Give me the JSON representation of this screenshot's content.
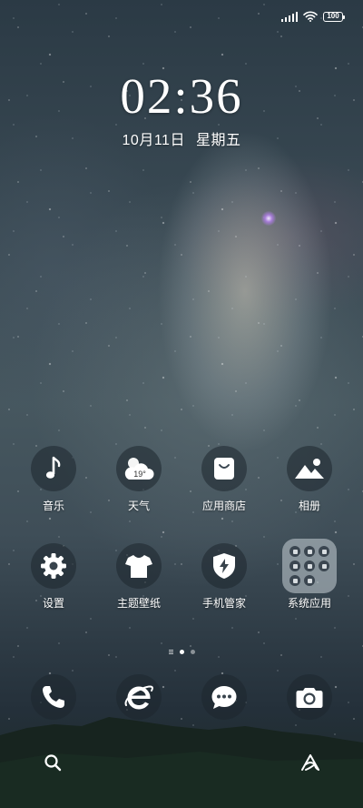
{
  "status_bar": {
    "battery_level": "100",
    "signal_icon": "signal-bars-icon",
    "wifi_icon": "wifi-icon",
    "battery_icon": "battery-icon"
  },
  "lock_clock": {
    "time": "02:36",
    "date": "10月11日",
    "weekday": "星期五"
  },
  "apps_row1": [
    {
      "label": "音乐",
      "icon": "music-note-icon"
    },
    {
      "label": "天气",
      "icon": "weather-cloud-icon",
      "badge": "19°"
    },
    {
      "label": "应用商店",
      "icon": "shopping-bag-icon"
    },
    {
      "label": "相册",
      "icon": "mountain-photo-icon"
    }
  ],
  "apps_row2": [
    {
      "label": "设置",
      "icon": "gear-icon"
    },
    {
      "label": "主题壁纸",
      "icon": "tshirt-icon"
    },
    {
      "label": "手机管家",
      "icon": "shield-bolt-icon"
    },
    {
      "label": "系统应用",
      "icon": "folder-icon"
    }
  ],
  "page_indicator": {
    "pages": 2,
    "current": 1
  },
  "dock": [
    {
      "name": "phone",
      "icon": "phone-icon"
    },
    {
      "name": "browser",
      "icon": "browser-e-icon"
    },
    {
      "name": "messages",
      "icon": "chat-bubble-icon"
    },
    {
      "name": "camera",
      "icon": "camera-icon"
    }
  ],
  "bottom_bar": {
    "left_icon": "search-icon",
    "right_icon": "assistant-icon"
  }
}
